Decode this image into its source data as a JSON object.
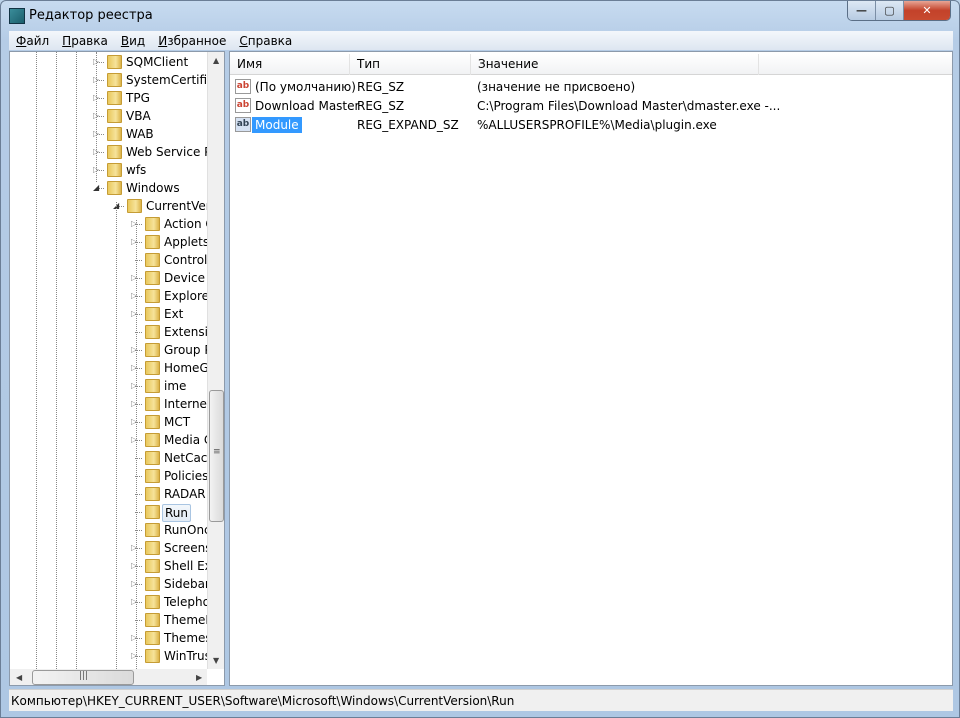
{
  "window": {
    "title": "Редактор реестра",
    "controls": {
      "minimize": "—",
      "maximize": "▢",
      "close": "✕"
    }
  },
  "menu": [
    {
      "u": "Ф",
      "rest": "айл"
    },
    {
      "u": "П",
      "rest": "равка"
    },
    {
      "u": "В",
      "rest": "ид"
    },
    {
      "u": "И",
      "rest": "збранное"
    },
    {
      "u": "С",
      "rest": "правка"
    }
  ],
  "tree": [
    {
      "label": "SQMClient",
      "level": 0,
      "expander": "collapsed"
    },
    {
      "label": "SystemCertificates",
      "level": 0,
      "expander": "collapsed"
    },
    {
      "label": "TPG",
      "level": 0,
      "expander": "collapsed"
    },
    {
      "label": "VBA",
      "level": 0,
      "expander": "collapsed"
    },
    {
      "label": "WAB",
      "level": 0,
      "expander": "collapsed"
    },
    {
      "label": "Web Service Providers",
      "level": 0,
      "expander": "collapsed"
    },
    {
      "label": "wfs",
      "level": 0,
      "expander": "collapsed"
    },
    {
      "label": "Windows",
      "level": 0,
      "expander": "expanded"
    },
    {
      "label": "CurrentVersion",
      "level": 1,
      "expander": "expanded"
    },
    {
      "label": "Action Center",
      "level": 2,
      "expander": "collapsed"
    },
    {
      "label": "Applets",
      "level": 2,
      "expander": "collapsed"
    },
    {
      "label": "Controls Folder",
      "level": 2,
      "expander": "none"
    },
    {
      "label": "Device Metadata",
      "level": 2,
      "expander": "collapsed"
    },
    {
      "label": "Explorer",
      "level": 2,
      "expander": "collapsed"
    },
    {
      "label": "Ext",
      "level": 2,
      "expander": "collapsed"
    },
    {
      "label": "Extensions",
      "level": 2,
      "expander": "none"
    },
    {
      "label": "Group Policy",
      "level": 2,
      "expander": "collapsed"
    },
    {
      "label": "HomeGroup",
      "level": 2,
      "expander": "collapsed"
    },
    {
      "label": "ime",
      "level": 2,
      "expander": "collapsed"
    },
    {
      "label": "Internet Settings",
      "level": 2,
      "expander": "collapsed"
    },
    {
      "label": "MCT",
      "level": 2,
      "expander": "collapsed"
    },
    {
      "label": "Media Center",
      "level": 2,
      "expander": "collapsed"
    },
    {
      "label": "NetCache",
      "level": 2,
      "expander": "none"
    },
    {
      "label": "Policies",
      "level": 2,
      "expander": "none"
    },
    {
      "label": "RADAR",
      "level": 2,
      "expander": "none"
    },
    {
      "label": "Run",
      "level": 2,
      "expander": "none",
      "selected": true
    },
    {
      "label": "RunOnce",
      "level": 2,
      "expander": "none"
    },
    {
      "label": "Screensavers",
      "level": 2,
      "expander": "collapsed"
    },
    {
      "label": "Shell Extensions",
      "level": 2,
      "expander": "collapsed"
    },
    {
      "label": "Sidebar",
      "level": 2,
      "expander": "collapsed"
    },
    {
      "label": "Telephony",
      "level": 2,
      "expander": "collapsed"
    },
    {
      "label": "ThemeManager",
      "level": 2,
      "expander": "none"
    },
    {
      "label": "Themes",
      "level": 2,
      "expander": "collapsed"
    },
    {
      "label": "WinTrust",
      "level": 2,
      "expander": "collapsed"
    }
  ],
  "list": {
    "columns": [
      "Имя",
      "Тип",
      "Значение"
    ],
    "rows": [
      {
        "name": "(По умолчанию)",
        "type": "REG_SZ",
        "value": "(значение не присвоено)",
        "icon": "string-value-icon"
      },
      {
        "name": "Download Master",
        "type": "REG_SZ",
        "value": "C:\\Program Files\\Download Master\\dmaster.exe -...",
        "icon": "string-value-icon"
      },
      {
        "name": "Module",
        "type": "REG_EXPAND_SZ",
        "value": "%ALLUSERSPROFILE%\\Media\\plugin.exe",
        "icon": "expand-string-value-icon",
        "selected": true
      }
    ]
  },
  "status": "Компьютер\\HKEY_CURRENT_USER\\Software\\Microsoft\\Windows\\CurrentVersion\\Run",
  "colors": {
    "selection": "#3399ff",
    "close": "#c84a30"
  }
}
